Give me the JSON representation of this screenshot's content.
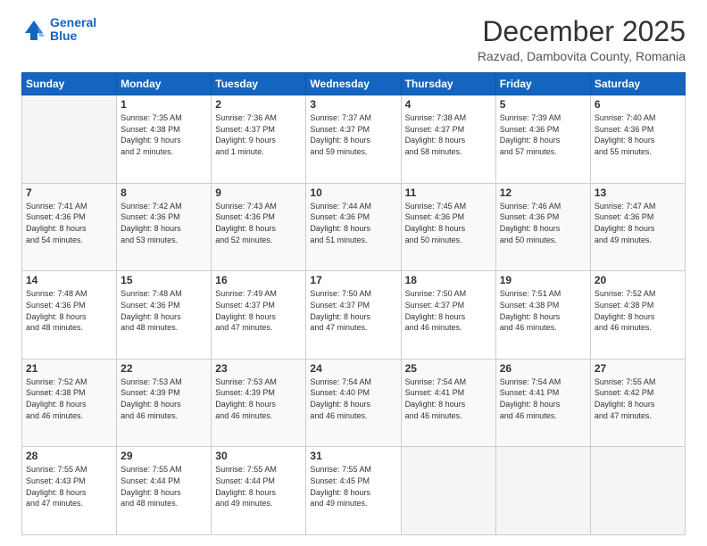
{
  "header": {
    "logo_line1": "General",
    "logo_line2": "Blue",
    "main_title": "December 2025",
    "subtitle": "Razvad, Dambovita County, Romania"
  },
  "days_of_week": [
    "Sunday",
    "Monday",
    "Tuesday",
    "Wednesday",
    "Thursday",
    "Friday",
    "Saturday"
  ],
  "weeks": [
    [
      {
        "day": "",
        "text": ""
      },
      {
        "day": "1",
        "text": "Sunrise: 7:35 AM\nSunset: 4:38 PM\nDaylight: 9 hours\nand 2 minutes."
      },
      {
        "day": "2",
        "text": "Sunrise: 7:36 AM\nSunset: 4:37 PM\nDaylight: 9 hours\nand 1 minute."
      },
      {
        "day": "3",
        "text": "Sunrise: 7:37 AM\nSunset: 4:37 PM\nDaylight: 8 hours\nand 59 minutes."
      },
      {
        "day": "4",
        "text": "Sunrise: 7:38 AM\nSunset: 4:37 PM\nDaylight: 8 hours\nand 58 minutes."
      },
      {
        "day": "5",
        "text": "Sunrise: 7:39 AM\nSunset: 4:36 PM\nDaylight: 8 hours\nand 57 minutes."
      },
      {
        "day": "6",
        "text": "Sunrise: 7:40 AM\nSunset: 4:36 PM\nDaylight: 8 hours\nand 55 minutes."
      }
    ],
    [
      {
        "day": "7",
        "text": "Sunrise: 7:41 AM\nSunset: 4:36 PM\nDaylight: 8 hours\nand 54 minutes."
      },
      {
        "day": "8",
        "text": "Sunrise: 7:42 AM\nSunset: 4:36 PM\nDaylight: 8 hours\nand 53 minutes."
      },
      {
        "day": "9",
        "text": "Sunrise: 7:43 AM\nSunset: 4:36 PM\nDaylight: 8 hours\nand 52 minutes."
      },
      {
        "day": "10",
        "text": "Sunrise: 7:44 AM\nSunset: 4:36 PM\nDaylight: 8 hours\nand 51 minutes."
      },
      {
        "day": "11",
        "text": "Sunrise: 7:45 AM\nSunset: 4:36 PM\nDaylight: 8 hours\nand 50 minutes."
      },
      {
        "day": "12",
        "text": "Sunrise: 7:46 AM\nSunset: 4:36 PM\nDaylight: 8 hours\nand 50 minutes."
      },
      {
        "day": "13",
        "text": "Sunrise: 7:47 AM\nSunset: 4:36 PM\nDaylight: 8 hours\nand 49 minutes."
      }
    ],
    [
      {
        "day": "14",
        "text": "Sunrise: 7:48 AM\nSunset: 4:36 PM\nDaylight: 8 hours\nand 48 minutes."
      },
      {
        "day": "15",
        "text": "Sunrise: 7:48 AM\nSunset: 4:36 PM\nDaylight: 8 hours\nand 48 minutes."
      },
      {
        "day": "16",
        "text": "Sunrise: 7:49 AM\nSunset: 4:37 PM\nDaylight: 8 hours\nand 47 minutes."
      },
      {
        "day": "17",
        "text": "Sunrise: 7:50 AM\nSunset: 4:37 PM\nDaylight: 8 hours\nand 47 minutes."
      },
      {
        "day": "18",
        "text": "Sunrise: 7:50 AM\nSunset: 4:37 PM\nDaylight: 8 hours\nand 46 minutes."
      },
      {
        "day": "19",
        "text": "Sunrise: 7:51 AM\nSunset: 4:38 PM\nDaylight: 8 hours\nand 46 minutes."
      },
      {
        "day": "20",
        "text": "Sunrise: 7:52 AM\nSunset: 4:38 PM\nDaylight: 8 hours\nand 46 minutes."
      }
    ],
    [
      {
        "day": "21",
        "text": "Sunrise: 7:52 AM\nSunset: 4:38 PM\nDaylight: 8 hours\nand 46 minutes."
      },
      {
        "day": "22",
        "text": "Sunrise: 7:53 AM\nSunset: 4:39 PM\nDaylight: 8 hours\nand 46 minutes."
      },
      {
        "day": "23",
        "text": "Sunrise: 7:53 AM\nSunset: 4:39 PM\nDaylight: 8 hours\nand 46 minutes."
      },
      {
        "day": "24",
        "text": "Sunrise: 7:54 AM\nSunset: 4:40 PM\nDaylight: 8 hours\nand 46 minutes."
      },
      {
        "day": "25",
        "text": "Sunrise: 7:54 AM\nSunset: 4:41 PM\nDaylight: 8 hours\nand 46 minutes."
      },
      {
        "day": "26",
        "text": "Sunrise: 7:54 AM\nSunset: 4:41 PM\nDaylight: 8 hours\nand 46 minutes."
      },
      {
        "day": "27",
        "text": "Sunrise: 7:55 AM\nSunset: 4:42 PM\nDaylight: 8 hours\nand 47 minutes."
      }
    ],
    [
      {
        "day": "28",
        "text": "Sunrise: 7:55 AM\nSunset: 4:43 PM\nDaylight: 8 hours\nand 47 minutes."
      },
      {
        "day": "29",
        "text": "Sunrise: 7:55 AM\nSunset: 4:44 PM\nDaylight: 8 hours\nand 48 minutes."
      },
      {
        "day": "30",
        "text": "Sunrise: 7:55 AM\nSunset: 4:44 PM\nDaylight: 8 hours\nand 49 minutes."
      },
      {
        "day": "31",
        "text": "Sunrise: 7:55 AM\nSunset: 4:45 PM\nDaylight: 8 hours\nand 49 minutes."
      },
      {
        "day": "",
        "text": ""
      },
      {
        "day": "",
        "text": ""
      },
      {
        "day": "",
        "text": ""
      }
    ]
  ]
}
